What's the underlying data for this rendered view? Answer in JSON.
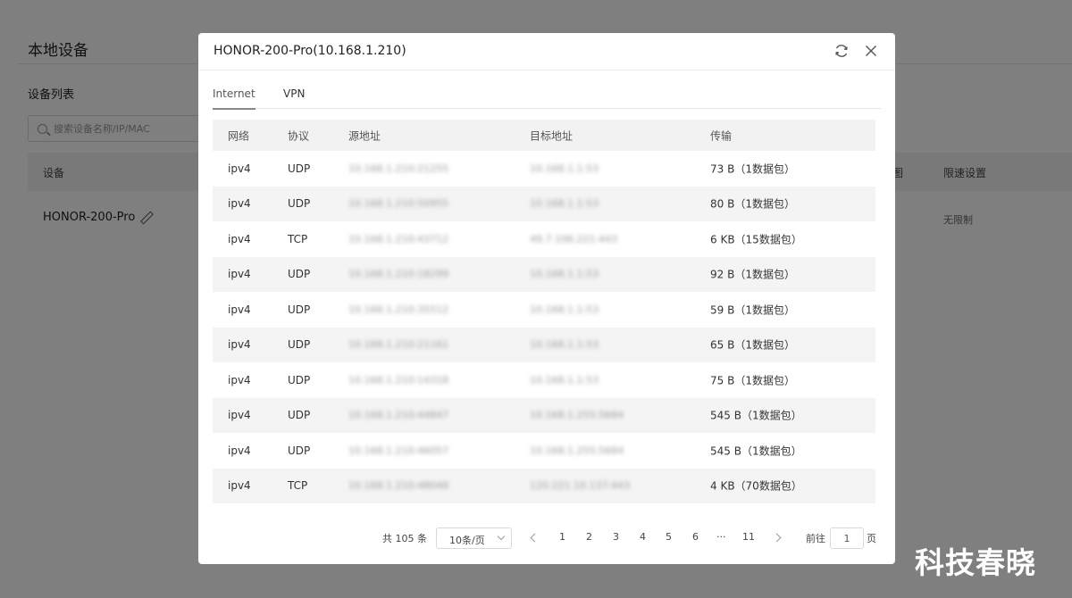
{
  "background": {
    "page_title": "本地设备",
    "list_title": "设备列表",
    "search_placeholder": "搜索设备名称/IP/MAC",
    "table_headers": {
      "device": "设备",
      "traffic": "图",
      "rate_limit": "限速设置"
    },
    "device_name": "HONOR-200-Pro",
    "rate_limit_value": "无限制"
  },
  "modal": {
    "title": "HONOR-200-Pro(10.168.1.210)",
    "tabs": [
      {
        "label": "Internet",
        "active": true
      },
      {
        "label": "VPN",
        "active": false
      }
    ],
    "columns": [
      "网络",
      "协议",
      "源地址",
      "目标地址",
      "传输"
    ],
    "rows": [
      {
        "network": "ipv4",
        "protocol": "UDP",
        "source": "10.168.1.210:21255",
        "destination": "10.168.1.1:53",
        "transfer": "73 B（1数据包）"
      },
      {
        "network": "ipv4",
        "protocol": "UDP",
        "source": "10.168.1.210:50955",
        "destination": "10.168.1.1:53",
        "transfer": "80 B（1数据包）"
      },
      {
        "network": "ipv4",
        "protocol": "TCP",
        "source": "10.168.1.210:43712",
        "destination": "49.7.106.221:443",
        "transfer": "6 KB（15数据包）"
      },
      {
        "network": "ipv4",
        "protocol": "UDP",
        "source": "10.168.1.210:18299",
        "destination": "10.168.1.1:53",
        "transfer": "92 B（1数据包）"
      },
      {
        "network": "ipv4",
        "protocol": "UDP",
        "source": "10.168.1.210:35512",
        "destination": "10.168.1.1:53",
        "transfer": "59 B（1数据包）"
      },
      {
        "network": "ipv4",
        "protocol": "UDP",
        "source": "10.168.1.210:21161",
        "destination": "10.168.1.1:53",
        "transfer": "65 B（1数据包）"
      },
      {
        "network": "ipv4",
        "protocol": "UDP",
        "source": "10.168.1.210:14318",
        "destination": "10.168.1.1:53",
        "transfer": "75 B（1数据包）"
      },
      {
        "network": "ipv4",
        "protocol": "UDP",
        "source": "10.168.1.210:44847",
        "destination": "10.168.1.255:5684",
        "transfer": "545 B（1数据包）"
      },
      {
        "network": "ipv4",
        "protocol": "UDP",
        "source": "10.168.1.210:46057",
        "destination": "10.168.1.255:5684",
        "transfer": "545 B（1数据包）"
      },
      {
        "network": "ipv4",
        "protocol": "TCP",
        "source": "10.168.1.210:48048",
        "destination": "120.221.10.137:443",
        "transfer": "4 KB（70数据包）"
      }
    ],
    "pagination": {
      "total": "共 105 条",
      "page_size": "10条/页",
      "pages": [
        "1",
        "2",
        "3",
        "4",
        "5",
        "6",
        "···",
        "11"
      ],
      "jump_prefix": "前往",
      "jump_value": "1",
      "jump_suffix": "页"
    }
  },
  "watermark": "科技春晓",
  "icons": [
    "refresh-icon",
    "close-icon",
    "search-icon",
    "edit-icon",
    "chevron-down-icon",
    "chevron-left-icon",
    "chevron-right-icon"
  ]
}
